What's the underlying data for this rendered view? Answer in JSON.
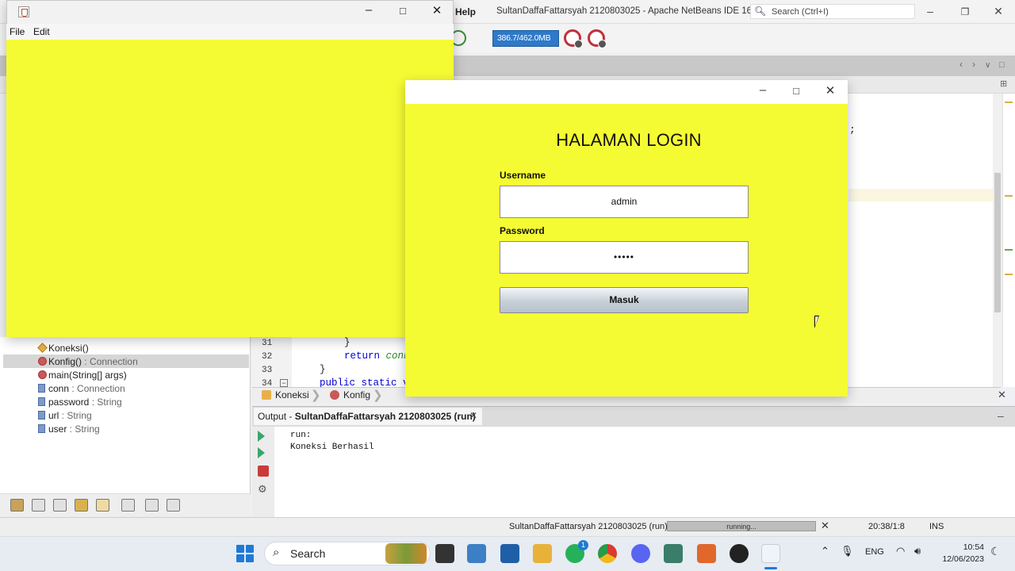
{
  "ide": {
    "menu_help": "Help",
    "title": "SultanDaffaFattarsyah 2120803025 - Apache NetBeans IDE 16",
    "search_placeholder": "Search (Ctrl+I)",
    "memory": "386.7/462.0MB",
    "code_lines": [
      {
        "no": "31",
        "text": "}"
      },
      {
        "no": "32",
        "text": "return conn"
      },
      {
        "no": "33",
        "text": "}"
      },
      {
        "no": "34",
        "text": "public static v"
      }
    ],
    "breadcrumbs": [
      "Koneksi",
      "Konfig"
    ]
  },
  "navigator": {
    "items": [
      {
        "name": "Koneksi()",
        "type": ""
      },
      {
        "name": "Konfig()",
        "type": " : Connection"
      },
      {
        "name": "main(String[] args)",
        "type": ""
      },
      {
        "name": "conn",
        "type": " : Connection"
      },
      {
        "name": "password",
        "type": " : String"
      },
      {
        "name": "url",
        "type": " : String"
      },
      {
        "name": "user",
        "type": " : String"
      }
    ]
  },
  "output": {
    "tab_prefix": "Output - ",
    "tab_project": "SultanDaffaFattarsyah 2120803025 (run)",
    "lines": [
      "run:",
      "Koneksi Berhasil"
    ]
  },
  "status": {
    "project": "SultanDaffaFattarsyah 2120803025 (run)",
    "progress_label": "running...",
    "position": "20:38/1:8",
    "mode": "INS"
  },
  "swing_window": {
    "menus": [
      "File",
      "Edit"
    ],
    "background": "#f5fb33"
  },
  "login": {
    "heading": "HALAMAN LOGIN",
    "username_label": "Username",
    "username_value": "admin",
    "password_label": "Password",
    "password_value": "•••••",
    "submit_label": "Masuk",
    "background": "#f5fb33"
  },
  "taskbar": {
    "search_label": "Search",
    "language": "ENG",
    "time": "10:54",
    "date": "12/06/2023",
    "whatsapp_badge": "1"
  }
}
